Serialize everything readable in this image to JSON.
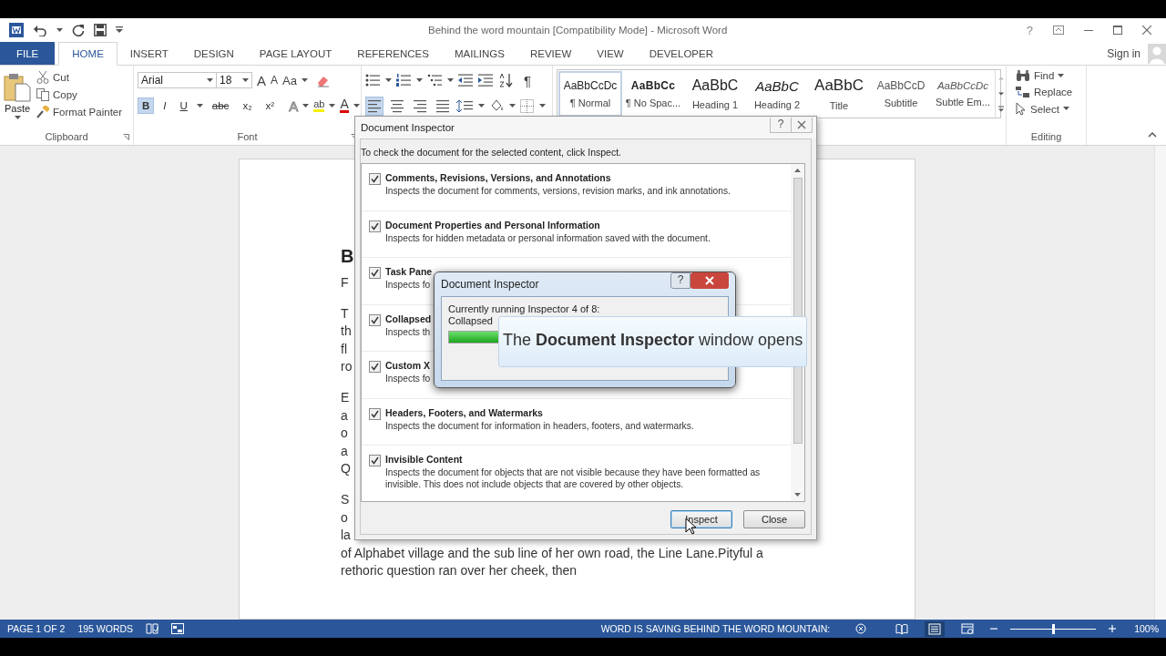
{
  "window": {
    "title": "Behind the word mountain [Compatibility Mode] - Microsoft Word",
    "help": "?"
  },
  "tabs": [
    {
      "label": "FILE",
      "kind": "file",
      "selected": false
    },
    {
      "label": "HOME",
      "kind": "tab",
      "selected": true
    },
    {
      "label": "INSERT",
      "kind": "tab",
      "selected": false
    },
    {
      "label": "DESIGN",
      "kind": "tab",
      "selected": false
    },
    {
      "label": "PAGE LAYOUT",
      "kind": "tab",
      "selected": false
    },
    {
      "label": "REFERENCES",
      "kind": "tab",
      "selected": false
    },
    {
      "label": "MAILINGS",
      "kind": "tab",
      "selected": false
    },
    {
      "label": "REVIEW",
      "kind": "tab",
      "selected": false
    },
    {
      "label": "VIEW",
      "kind": "tab",
      "selected": false
    },
    {
      "label": "DEVELOPER",
      "kind": "tab",
      "selected": false
    }
  ],
  "account": {
    "label": "Sign in"
  },
  "ribbon": {
    "clipboard": {
      "paste": "Paste",
      "cut": "Cut",
      "copy": "Copy",
      "format_painter": "Format Painter",
      "group_label": "Clipboard"
    },
    "font": {
      "name": "Arial",
      "size": "18",
      "grow": "A",
      "shrink": "A",
      "change_case": "Aa",
      "group_label": "Font",
      "format_buttons": [
        {
          "label": "B",
          "kind": "bold",
          "on": true
        },
        {
          "label": "I",
          "kind": "italic",
          "on": false
        },
        {
          "label": "U",
          "kind": "underline",
          "on": false
        },
        {
          "label": "abc",
          "kind": "strike",
          "on": false
        },
        {
          "label": "x₂",
          "kind": "sub",
          "on": false
        },
        {
          "label": "x²",
          "kind": "sup",
          "on": false
        }
      ],
      "text_effects": "A",
      "highlight": "ab",
      "font_color": "A"
    },
    "paragraph": {
      "pilcrow": "¶",
      "alignment": [
        {
          "kind": "left",
          "selected": true
        },
        {
          "kind": "center",
          "selected": false
        },
        {
          "kind": "right",
          "selected": false
        },
        {
          "kind": "justify",
          "selected": false
        }
      ]
    },
    "styles": [
      {
        "preview": "AaBbCcDc",
        "name": "¶ Normal",
        "kind": "normal",
        "selected": true
      },
      {
        "preview": "AaBbCc",
        "name": "¶ No Spac...",
        "kind": "nospacing",
        "selected": false
      },
      {
        "preview": "AaBbC",
        "name": "Heading 1",
        "kind": "heading1",
        "selected": false
      },
      {
        "preview": "AaBbC",
        "name": "Heading 2",
        "kind": "heading2",
        "selected": false
      },
      {
        "preview": "AaBbC",
        "name": "Title",
        "kind": "title",
        "selected": false
      },
      {
        "preview": "AaBbCcD",
        "name": "Subtitle",
        "kind": "subtitle",
        "selected": false
      },
      {
        "preview": "AaBbCcDc",
        "name": "Subtle Em...",
        "kind": "emphasis",
        "selected": false
      }
    ],
    "editing": {
      "find": "Find",
      "replace": "Replace",
      "select": "Select",
      "group_label": "Editing"
    }
  },
  "document": {
    "heading": "B",
    "paragraphs": [
      [
        "F"
      ],
      [
        "T",
        "th",
        "fl",
        "ro"
      ],
      [
        "E",
        "a",
        "o",
        "a",
        "Q"
      ],
      [
        "S",
        "o",
        "la",
        "of Alphabet village and the sub line of her own road, the Line Lane.Pityful a",
        "rethoric question ran over her cheek, then"
      ]
    ]
  },
  "dialog": {
    "title": "Document Inspector",
    "help": "?",
    "instruction": "To check the document for the selected content, click Inspect.",
    "items": [
      {
        "title": "Comments, Revisions, Versions, and Annotations",
        "description": "Inspects the document for comments, versions, revision marks, and ink annotations.",
        "checked": true
      },
      {
        "title": "Document Properties and Personal Information",
        "description": "Inspects for hidden metadata or personal information saved with the document.",
        "checked": true
      },
      {
        "title": "Task Pane",
        "description": "Inspects fo",
        "checked": true
      },
      {
        "title": "Collapsed",
        "description": "Inspects th",
        "checked": true
      },
      {
        "title": "Custom X",
        "description": "Inspects fo",
        "checked": true
      },
      {
        "title": "Headers, Footers, and Watermarks",
        "description": "Inspects the document for information in headers, footers, and watermarks.",
        "checked": true
      },
      {
        "title": "Invisible Content",
        "description": "Inspects the document for objects that are not visible because they have been formatted as invisible. This does not include objects that are covered by other objects.",
        "checked": true
      }
    ],
    "buttons": [
      {
        "label": "Inspect",
        "kind": "inspect"
      },
      {
        "label": "Close",
        "kind": "close"
      }
    ]
  },
  "progress": {
    "title": "Document Inspector",
    "help": "?",
    "status": "Currently running Inspector 4 of 8:",
    "current": "Collapsed",
    "level": 0.2
  },
  "caption": {
    "text": "The **Document Inspector** window opens"
  },
  "status_bar": {
    "page": "PAGE 1 OF 2",
    "words": "195 WORDS",
    "message": "WORD IS SAVING BEHIND THE WORD MOUNTAIN:",
    "views": [
      {
        "kind": "read",
        "selected": false
      },
      {
        "kind": "print",
        "selected": true
      },
      {
        "kind": "web",
        "selected": false
      }
    ],
    "zoom": {
      "level": 0.5,
      "reading": "100%"
    }
  }
}
